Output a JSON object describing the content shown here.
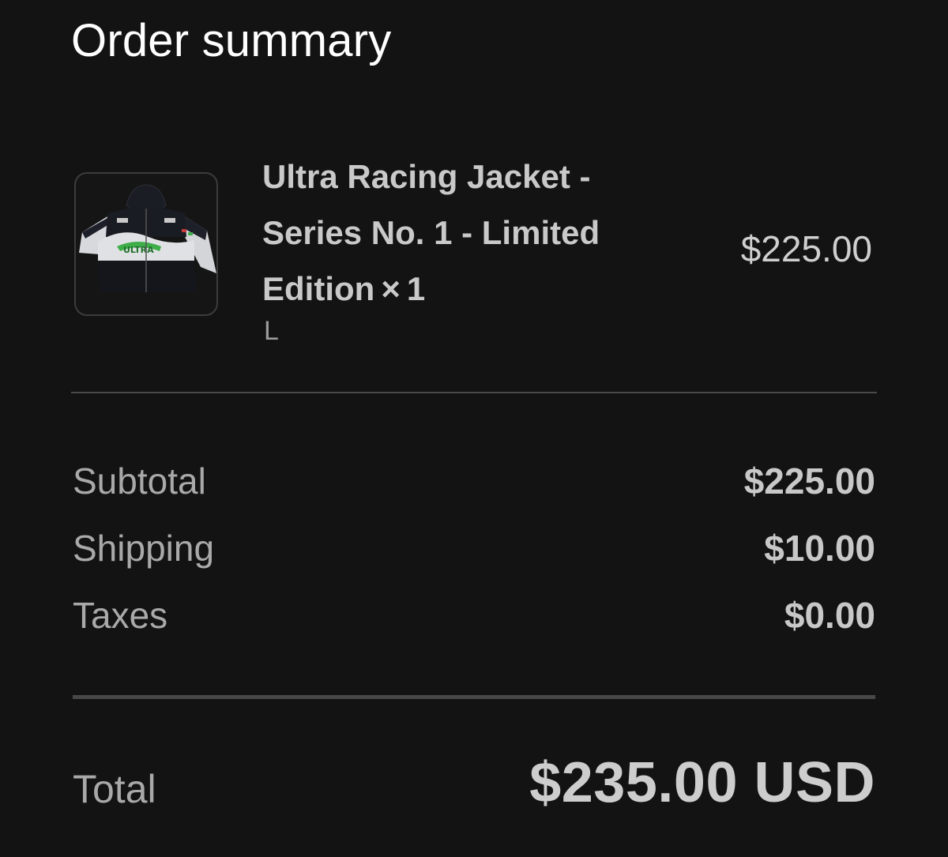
{
  "summary": {
    "title": "Order summary"
  },
  "item": {
    "name": "Ultra Racing Jacket - Series No. 1 - Limited Edition",
    "qty_sep": "×",
    "quantity": "1",
    "variant": "L",
    "price": "$225.00",
    "image_icon": "jacket-thumbnail"
  },
  "costs": {
    "subtotal_label": "Subtotal",
    "subtotal_value": "$225.00",
    "shipping_label": "Shipping",
    "shipping_value": "$10.00",
    "taxes_label": "Taxes",
    "taxes_value": "$0.00"
  },
  "total": {
    "label": "Total",
    "value": "$235.00 USD"
  },
  "colors": {
    "background": "#131313",
    "title_text": "#ffffff",
    "primary_text": "#c9c9c9",
    "muted_text": "#a9a9a9",
    "divider": "#4a4a4a",
    "brand_green": "#3fae4a"
  }
}
